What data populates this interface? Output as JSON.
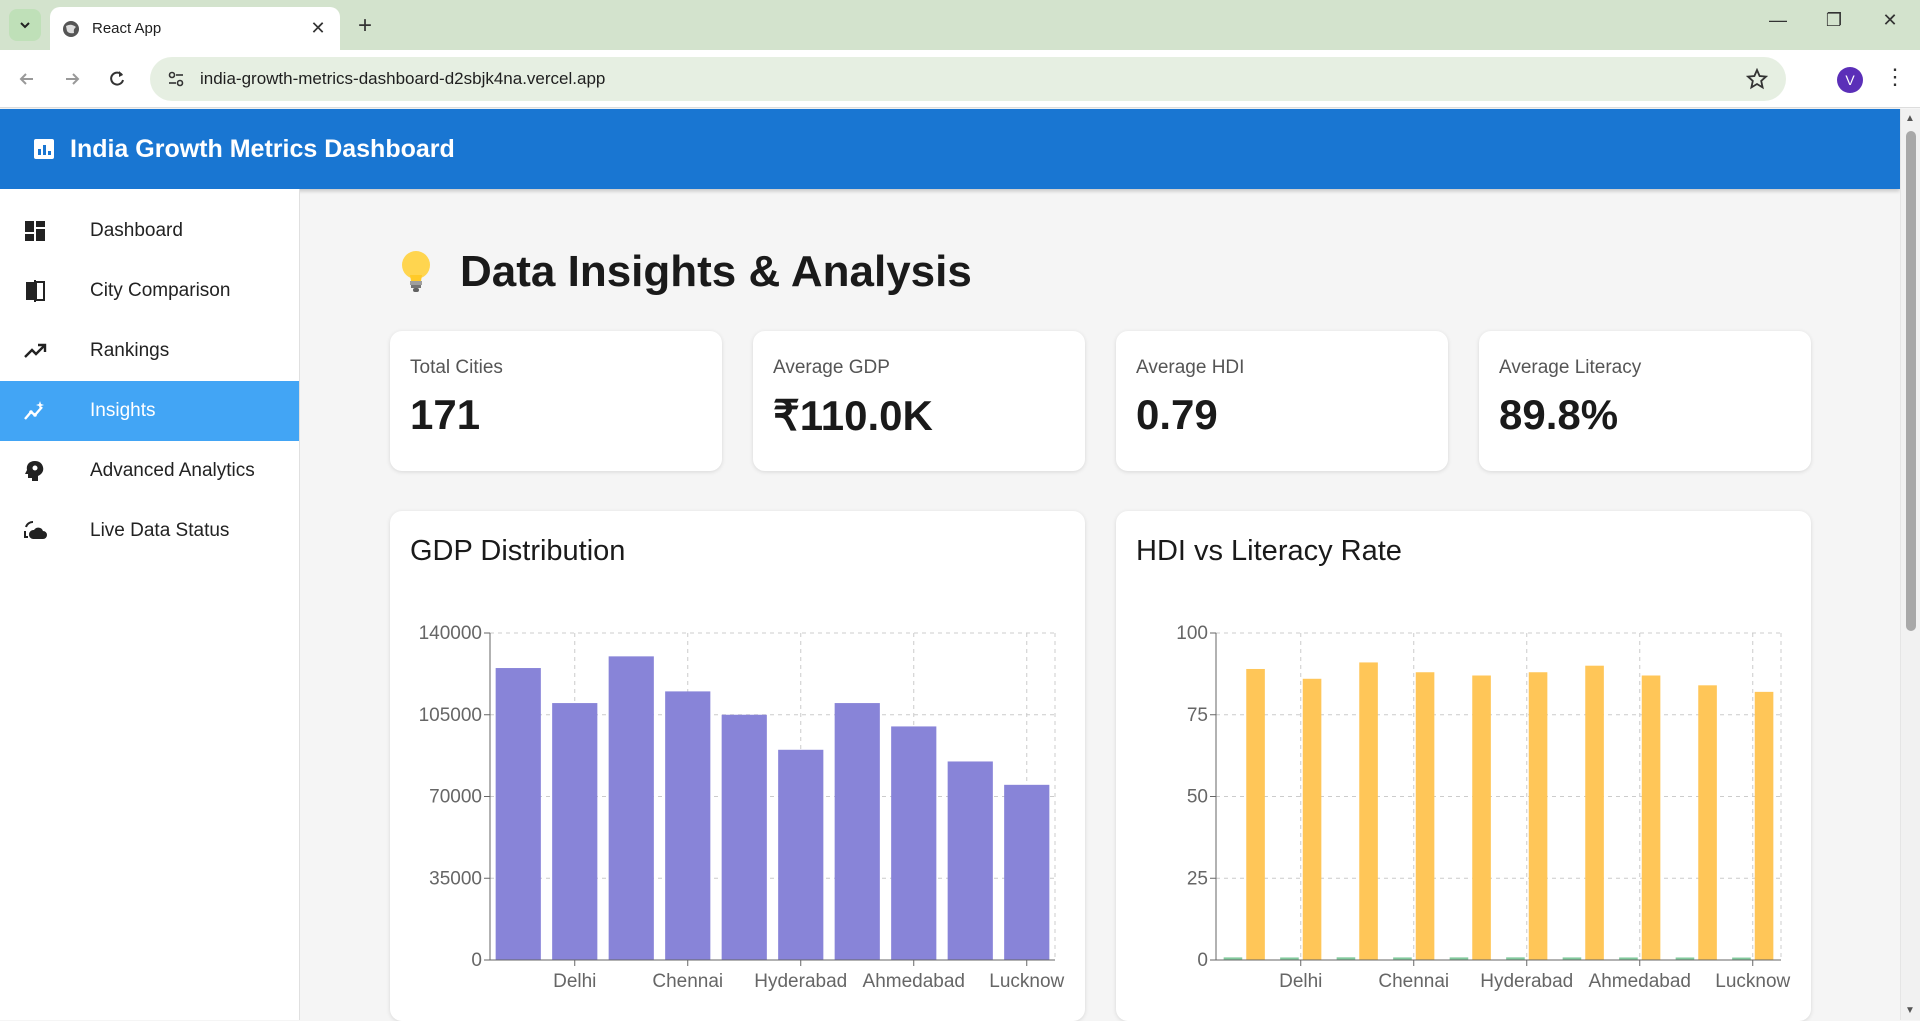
{
  "browser": {
    "tab_title": "React App",
    "url": "india-growth-metrics-dashboard-d2sbjk4na.vercel.app",
    "avatar_letter": "V"
  },
  "app": {
    "title": "India Growth Metrics Dashboard"
  },
  "sidebar": {
    "items": [
      {
        "label": "Dashboard",
        "icon": "dashboard-icon",
        "active": false
      },
      {
        "label": "City Comparison",
        "icon": "compare-icon",
        "active": false
      },
      {
        "label": "Rankings",
        "icon": "trending-up-icon",
        "active": false
      },
      {
        "label": "Insights",
        "icon": "insights-icon",
        "active": true
      },
      {
        "label": "Advanced Analytics",
        "icon": "psychology-icon",
        "active": false
      },
      {
        "label": "Live Data Status",
        "icon": "cloud-sync-icon",
        "active": false
      }
    ]
  },
  "page": {
    "title": "Data Insights & Analysis",
    "title_icon": "lightbulb-icon"
  },
  "stats": [
    {
      "label": "Total Cities",
      "value": "171"
    },
    {
      "label": "Average GDP",
      "value": "₹110.0K"
    },
    {
      "label": "Average HDI",
      "value": "0.79"
    },
    {
      "label": "Average Literacy",
      "value": "89.8%"
    }
  ],
  "colors": {
    "header_blue": "#1976d2",
    "active_nav": "#42a5f5",
    "gdp_bar": "#8884d8",
    "literacy_bar": "#ffc658",
    "hdi_bar": "#82ca9d"
  },
  "chart_data": [
    {
      "type": "bar",
      "title": "GDP Distribution",
      "categories": [
        "",
        "Delhi",
        "",
        "Chennai",
        "",
        "Hyderabad",
        "",
        "Ahmedabad",
        "",
        "Lucknow"
      ],
      "tick_labels": [
        "Delhi",
        "Chennai",
        "Hyderabad",
        "Ahmedabad",
        "Lucknow"
      ],
      "values": [
        125000,
        110000,
        130000,
        115000,
        105000,
        90000,
        110000,
        100000,
        85000,
        75000
      ],
      "yticks": [
        "0",
        "35000",
        "70000",
        "105000",
        "140000"
      ],
      "ylim": [
        0,
        140000
      ],
      "grid": true
    },
    {
      "type": "bar",
      "title": "HDI vs Literacy Rate",
      "categories": [
        "",
        "Delhi",
        "",
        "Chennai",
        "",
        "Hyderabad",
        "",
        "Ahmedabad",
        "",
        "Lucknow"
      ],
      "tick_labels": [
        "Delhi",
        "Chennai",
        "Hyderabad",
        "Ahmedabad",
        "Lucknow"
      ],
      "series": [
        {
          "values": [
            0.8,
            0.78,
            0.82,
            0.79,
            0.8,
            0.81,
            0.79,
            0.78,
            0.77,
            0.75
          ]
        },
        {
          "values": [
            89,
            86,
            91,
            88,
            87,
            88,
            90,
            87,
            84,
            82
          ]
        }
      ],
      "yticks": [
        "0",
        "25",
        "50",
        "75",
        "100"
      ],
      "ylim": [
        0,
        100
      ],
      "grid": true
    }
  ]
}
